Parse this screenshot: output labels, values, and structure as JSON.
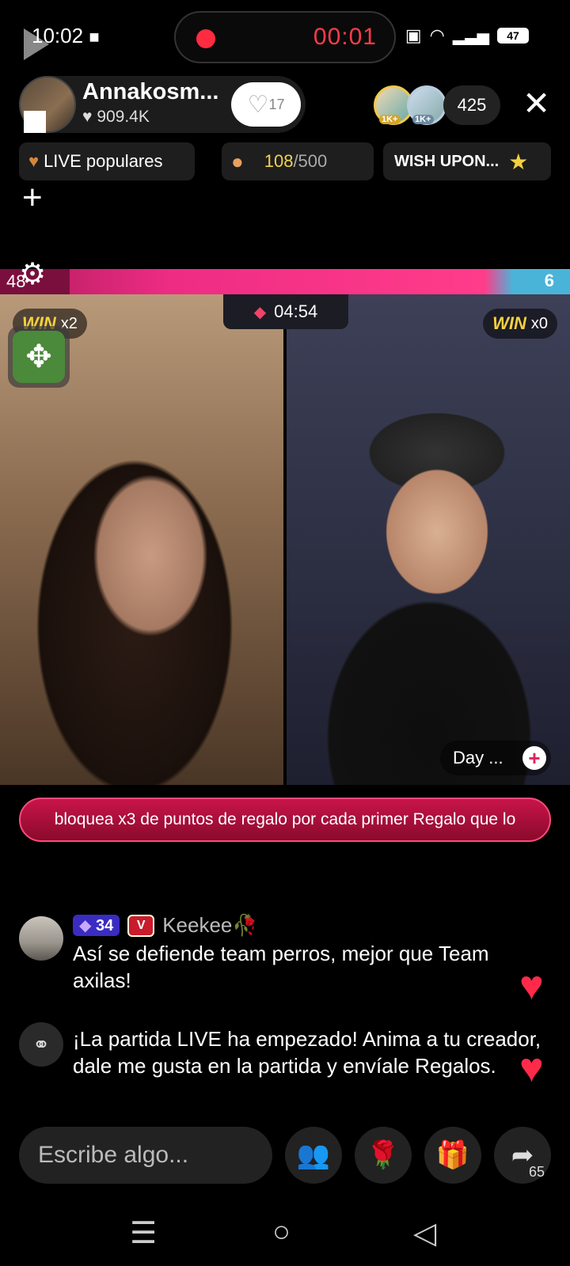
{
  "status": {
    "time": "10:02",
    "battery": "47",
    "recording_time": "00:01"
  },
  "host": {
    "name": "Annakosm...",
    "likes": "909.4K",
    "follow_count": "17"
  },
  "viewers": {
    "avatar1_badge": "1K+",
    "avatar2_badge": "1K+",
    "count": "425"
  },
  "chips": {
    "live_label": "LIVE populares",
    "goal_current": "108",
    "goal_total": "/500",
    "wish_label": "WISH UPON..."
  },
  "battle": {
    "left_score": "48",
    "right_score": "6",
    "timer": "04:54",
    "left_win_word": "WIN",
    "left_win_mult": "x2",
    "right_win_word": "WIN",
    "right_win_mult": "x0",
    "opponent_name": "Day ..."
  },
  "banner_text": "bloquea x3 de puntos de regalo por cada primer Regalo que lo",
  "comments": [
    {
      "level": "34",
      "badge": "V",
      "user": "Keekee🥀",
      "text": "Así se defiende team perros, mejor que Team axilas!"
    }
  ],
  "system_message": "¡La partida LIVE ha empezado! Anima a tu creador, dale me gusta en la partida y envíale Regalos.",
  "bottom": {
    "input_placeholder": "Escribe algo...",
    "share_count": "65"
  },
  "colors": {
    "accent_pink": "#ff2c84",
    "record_red": "#ff3b4a",
    "win_gold": "#f4d03f"
  }
}
